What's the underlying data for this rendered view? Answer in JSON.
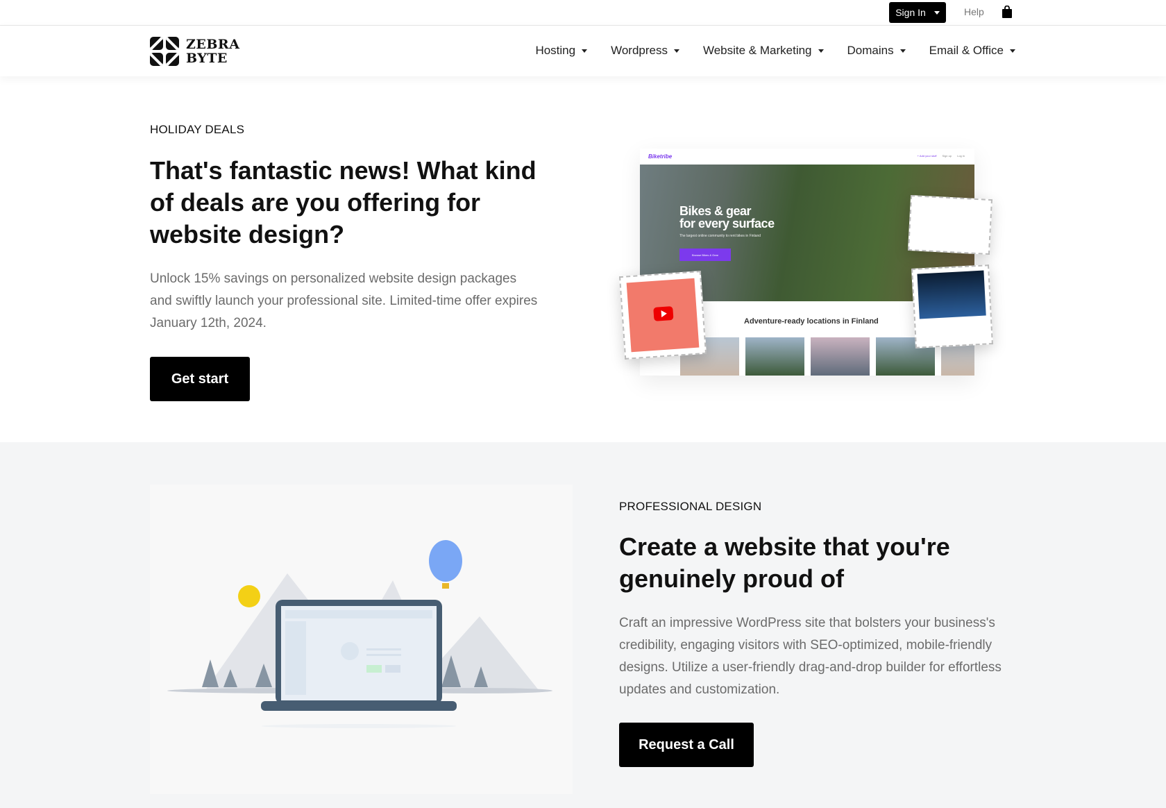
{
  "topbar": {
    "signin_label": "Sign In",
    "help_label": "Help",
    "cart_icon": "shopping-bag-icon"
  },
  "brand": {
    "line1": "ZEBRA",
    "line2": "BYTE"
  },
  "nav": [
    {
      "label": "Hosting"
    },
    {
      "label": "Wordpress"
    },
    {
      "label": "Website & Marketing"
    },
    {
      "label": "Domains"
    },
    {
      "label": "Email & Office"
    }
  ],
  "hero": {
    "eyebrow": "HOLIDAY DEALS",
    "title": "That's fantastic news! What kind of deals are you offering for website design?",
    "body": "Unlock 15% savings on personalized website design packages and swiftly launch your professional site. Limited-time offer expires January 12th, 2024.",
    "cta": "Get start",
    "mockup": {
      "brand": "Biketribe",
      "headline1": "Bikes & gear",
      "headline2": "for every surface",
      "sub": "The largest online community to rent bikes in Finland",
      "button": "Browse Bikes & Gear",
      "section": "Adventure-ready locations in Finland",
      "nav_links": [
        "+ Add your stuff",
        "Sign up",
        "Log in"
      ]
    }
  },
  "feature": {
    "eyebrow": "PROFESSIONAL DESIGN",
    "title": "Create a website that you're genuinely proud of",
    "body": "Craft an impressive WordPress site that bolsters your business's credibility, engaging visitors with SEO-optimized, mobile-friendly designs. Utilize a user-friendly drag-and-drop builder for effortless updates and customization.",
    "cta": "Request a Call"
  },
  "colors": {
    "accent": "#000000",
    "mockup_purple": "#7c3aed",
    "balloon": "#7aa7f5",
    "sun": "#f3d016",
    "laptop": "#475d72"
  }
}
